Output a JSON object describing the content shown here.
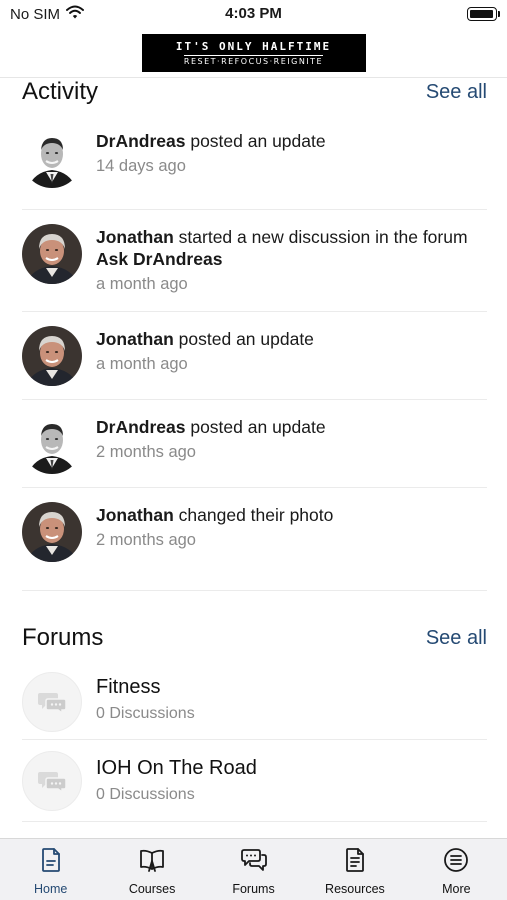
{
  "status_bar": {
    "carrier": "No SIM",
    "time": "4:03 PM",
    "battery_level": 0.95
  },
  "header": {
    "logo_line1": "IT'S ONLY HALFTIME",
    "logo_line2": "RESET·REFOCUS·REIGNITE"
  },
  "activity": {
    "title": "Activity",
    "see_all": "See all",
    "items": [
      {
        "author": "DrAndreas",
        "action": " posted an update",
        "time": "14 days ago",
        "avatar": "drandreas"
      },
      {
        "author": "Jonathan",
        "action": " started a new discussion in the forum ",
        "target": "Ask DrAndreas",
        "time": "a month ago",
        "avatar": "jonathan"
      },
      {
        "author": "Jonathan",
        "action": " posted an update",
        "time": "a month ago",
        "avatar": "jonathan"
      },
      {
        "author": "DrAndreas",
        "action": " posted an update",
        "time": "2 months ago",
        "avatar": "drandreas"
      },
      {
        "author": "Jonathan",
        "action": " changed their photo",
        "time": "2 months ago",
        "avatar": "jonathan"
      }
    ]
  },
  "forums": {
    "title": "Forums",
    "see_all": "See all",
    "items": [
      {
        "name": "Fitness",
        "count": "0 Discussions"
      },
      {
        "name": "IOH On The Road",
        "count": "0 Discussions"
      }
    ]
  },
  "tabs": [
    {
      "label": "Home",
      "icon": "home-doc-icon",
      "active": true
    },
    {
      "label": "Courses",
      "icon": "courses-book-icon",
      "active": false
    },
    {
      "label": "Forums",
      "icon": "forums-chat-icon",
      "active": false
    },
    {
      "label": "Resources",
      "icon": "resources-doc-icon",
      "active": false
    },
    {
      "label": "More",
      "icon": "more-menu-icon",
      "active": false
    }
  ],
  "colors": {
    "accent": "#254a73",
    "muted_text": "#8a8a8a",
    "tab_bar_bg": "#f1f1f3"
  }
}
